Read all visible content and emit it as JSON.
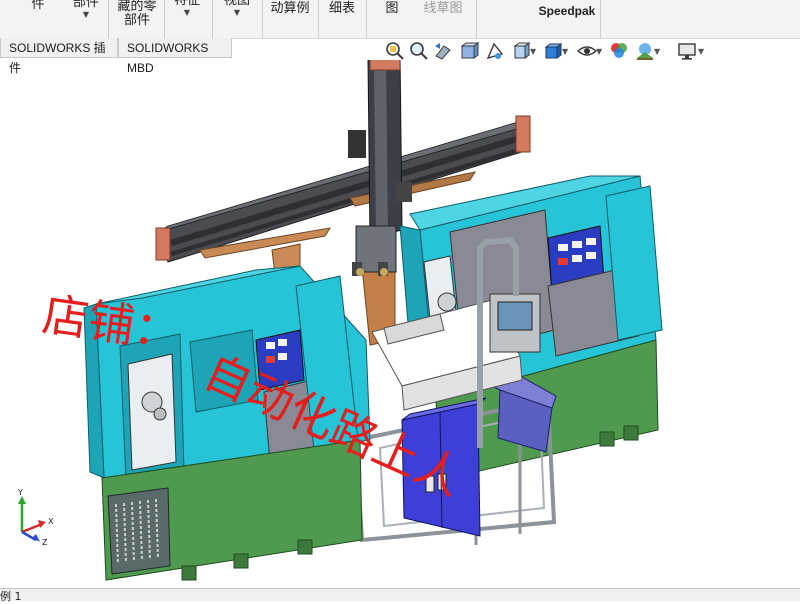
{
  "toolbar": {
    "items": [
      {
        "label": "件",
        "caret": false,
        "disabled": false
      },
      {
        "label": "部件",
        "caret": true,
        "disabled": false
      },
      {
        "label": "藏的零\n部件",
        "caret": false,
        "disabled": false
      },
      {
        "label": "特征",
        "caret": true,
        "disabled": false
      },
      {
        "label": "视图",
        "caret": true,
        "disabled": false
      },
      {
        "label": "动算例",
        "caret": false,
        "disabled": false
      },
      {
        "label": "细表",
        "caret": false,
        "disabled": false
      },
      {
        "label": "图",
        "caret": false,
        "disabled": false
      },
      {
        "label": "线草图",
        "caret": false,
        "disabled": true
      },
      {
        "label": "Speedpak",
        "caret": false,
        "disabled": false
      }
    ]
  },
  "tabs": [
    {
      "label": "SOLIDWORKS 插件"
    },
    {
      "label": "SOLIDWORKS MBD"
    }
  ],
  "heads_up": [
    {
      "icon": "zoom-to-fit-icon"
    },
    {
      "icon": "zoom-to-area-icon"
    },
    {
      "icon": "previous-view-icon"
    },
    {
      "icon": "section-view-icon"
    },
    {
      "icon": "dynamic-annotation-icon"
    },
    {
      "icon": "view-orientation-icon"
    },
    {
      "icon": "display-style-icon"
    },
    {
      "icon": "hide-show-items-icon"
    },
    {
      "icon": "edit-appearance-icon"
    },
    {
      "icon": "apply-scene-icon"
    },
    {
      "icon": "view-settings-icon"
    }
  ],
  "watermark": {
    "line1": "店铺：",
    "line2": "自动化路上人"
  },
  "triad": {
    "x": "X",
    "y": "Y",
    "z": "Z"
  },
  "status": {
    "text": "例 1"
  },
  "colors": {
    "machine_cyan": "#27c3d6",
    "machine_grey": "#8a8a96",
    "base_green": "#4f9a4e",
    "cabinet_blue": "#3d3fd6",
    "frame_grey": "#9aa0a8",
    "watermark_red": "#e41d1d"
  }
}
